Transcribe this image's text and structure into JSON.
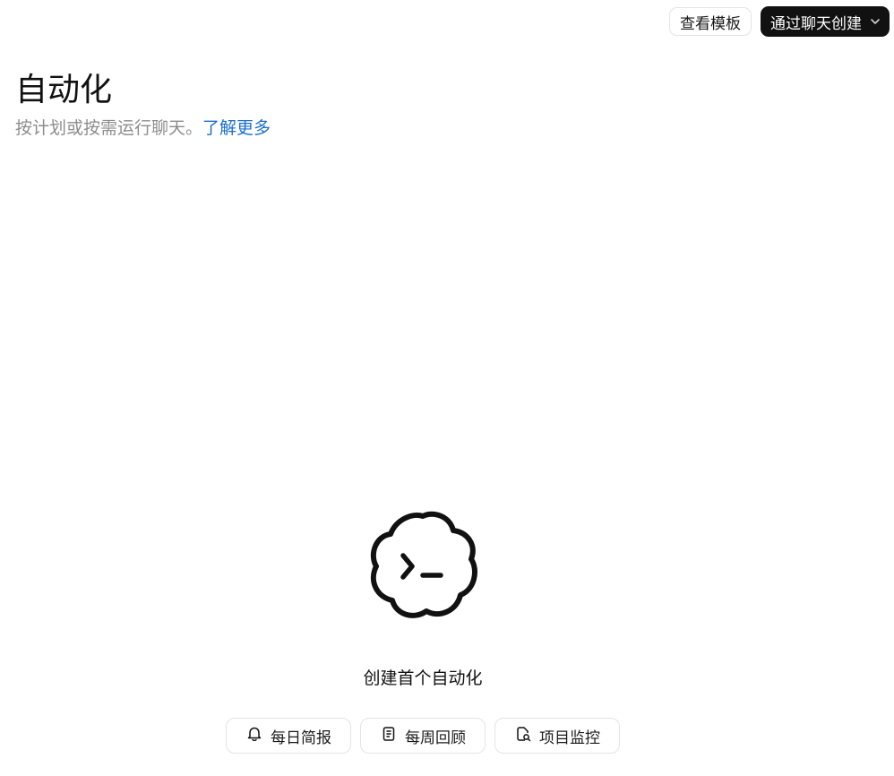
{
  "toolbar": {
    "view_templates_label": "查看模板",
    "create_via_chat_label": "通过聊天创建",
    "create_dropdown_icon": "chevron-down-icon"
  },
  "header": {
    "title": "自动化",
    "subtitle": "按计划或按需运行聊天。",
    "learn_more_link": "了解更多"
  },
  "empty_state": {
    "icon": "terminal-cloud-icon",
    "title": "创建首个自动化",
    "suggestions": [
      {
        "label": "每日简报",
        "icon": "bell-icon"
      },
      {
        "label": "每周回顾",
        "icon": "notes-icon"
      },
      {
        "label": "项目监控",
        "icon": "file-search-icon"
      }
    ]
  },
  "colors": {
    "primary_button_bg": "#111111",
    "link": "#1a6fd0",
    "muted_text": "#8c8c8c",
    "border": "#e4e4e4"
  }
}
